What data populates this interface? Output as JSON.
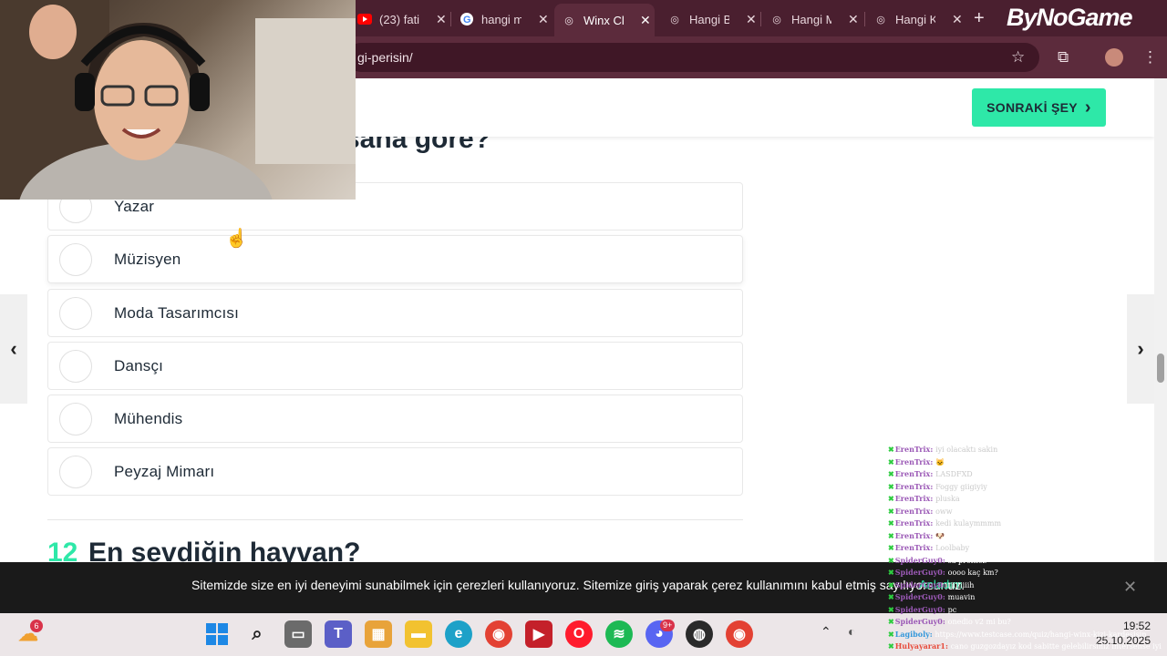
{
  "browser": {
    "tabs": [
      {
        "label": "(23) fatil",
        "icon": "youtube-icon",
        "color": "#ff0000"
      },
      {
        "label": "hangi m",
        "icon": "google-icon",
        "color": "#4285f4"
      },
      {
        "label": "Winx Cl",
        "icon": "site-icon",
        "color": "#ffffff",
        "active": true
      },
      {
        "label": "Hangi B",
        "icon": "site-icon",
        "color": "#ffffff"
      },
      {
        "label": "Hangi M",
        "icon": "site-icon",
        "color": "#ffffff"
      },
      {
        "label": "Hangi K",
        "icon": "site-icon",
        "color": "#ffffff"
      }
    ],
    "new_tab_symbol": "+",
    "close_symbol": "✕",
    "url": "gi-perisin/",
    "brand_overlay": "ByNoGame"
  },
  "page": {
    "next_button_label": "SONRAKİ ŞEY",
    "next_button_chevron": "›",
    "question_title_partial": "sana göre?",
    "options": [
      {
        "label": "Yazar"
      },
      {
        "label": "Müzisyen"
      },
      {
        "label": "Moda Tasarımcısı"
      },
      {
        "label": "Dansçı"
      },
      {
        "label": "Mühendis"
      },
      {
        "label": "Peyzaj Mimarı"
      }
    ],
    "next_question_number": "12",
    "next_question_title": "En sevdiğin hayvan?",
    "left_arrow": "‹",
    "right_arrow": "›",
    "accent_color": "#2ee8a8"
  },
  "cookie_banner": {
    "text": "Sitemizde size en iyi deneyimi sunabilmek için çerezleri kullanıyoruz. Sitemize giriş yaparak çerez kullanımını kabul etmiş sayılıyorsunuz.",
    "accept_link": "Anladım",
    "close_symbol": "✕"
  },
  "chat": [
    {
      "user": "ErenTrix:",
      "msg": "iyi olacaktı sakin",
      "color": "#9b59b6",
      "msg_color": "#c9c9c9"
    },
    {
      "user": "ErenTrix:",
      "msg": "🐱",
      "color": "#9b59b6",
      "msg_color": "#c9c9c9"
    },
    {
      "user": "ErenTrix:",
      "msg": "LASDFXD",
      "color": "#9b59b6",
      "msg_color": "#c9c9c9"
    },
    {
      "user": "ErenTrix:",
      "msg": "Foggy giigiyiy",
      "color": "#9b59b6",
      "msg_color": "#c9c9c9"
    },
    {
      "user": "ErenTrix:",
      "msg": "pluska",
      "color": "#9b59b6",
      "msg_color": "#c9c9c9"
    },
    {
      "user": "ErenTrix:",
      "msg": "oww",
      "color": "#9b59b6",
      "msg_color": "#c9c9c9"
    },
    {
      "user": "ErenTrix:",
      "msg": "kedi kulaymmmm",
      "color": "#9b59b6",
      "msg_color": "#c9c9c9"
    },
    {
      "user": "ErenTrix:",
      "msg": "🐶",
      "color": "#9b59b6",
      "msg_color": "#c9c9c9"
    },
    {
      "user": "ErenTrix:",
      "msg": "Loolbaby",
      "color": "#9b59b6",
      "msg_color": "#c9c9c9"
    },
    {
      "user": "SpiderGuy0:",
      "msg": "sa profnez",
      "color": "#9b59b6",
      "msg_color": "#ffffff"
    },
    {
      "user": "SpiderGuy0:",
      "msg": "oooo kaç km?",
      "color": "#9b59b6",
      "msg_color": "#ffffff"
    },
    {
      "user": "SpiderGuy0:",
      "msg": "tiiiiiiiih",
      "color": "#9b59b6",
      "msg_color": "#ffffff"
    },
    {
      "user": "SpiderGuy0:",
      "msg": "muavin",
      "color": "#9b59b6",
      "msg_color": "#ffffff"
    },
    {
      "user": "SpiderGuy0:",
      "msg": "pc",
      "color": "#9b59b6",
      "msg_color": "#ffffff"
    },
    {
      "user": "SpiderGuy0:",
      "msg": "onedio v2 mi bu?",
      "color": "#9b59b6",
      "msg_color": "#ffffff"
    },
    {
      "user": "Lagiboly:",
      "msg": "https://www.testcase.com/quiz/hangi-winx-kizi-kardesisin",
      "color": "#3498db",
      "msg_color": "#ffffff"
    },
    {
      "user": "Hulyayarar1:",
      "msg": "cano guzgozdayız kod sabitte gelebilirsiniz intersense iyi yayınlar bebek",
      "color": "#e74c3c",
      "msg_color": "#ffffff"
    }
  ],
  "taskbar": {
    "time": "19:52",
    "date": "25.10.2025",
    "weather_badge": "6",
    "discord_badge": "9+"
  }
}
